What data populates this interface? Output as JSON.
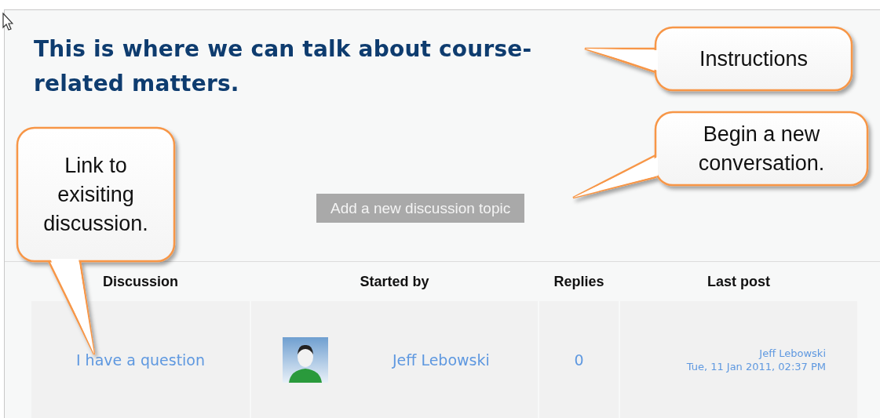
{
  "intro": {
    "heading": "This is where we can talk about course-related matters."
  },
  "add_button": {
    "label": "Add a new discussion topic"
  },
  "table": {
    "columns": [
      "Discussion",
      "Started by",
      "Replies",
      "Last post"
    ],
    "rows": [
      {
        "discussion": "I have a question",
        "started_by": "Jeff Lebowski",
        "replies": "0",
        "last_post_author": "Jeff Lebowski",
        "last_post_time": "Tue, 11 Jan 2011, 02:37 PM"
      }
    ]
  },
  "callouts": [
    {
      "text": "Instructions"
    },
    {
      "text": "Begin a new conversation."
    },
    {
      "text": "Link to exisiting discussion."
    }
  ]
}
